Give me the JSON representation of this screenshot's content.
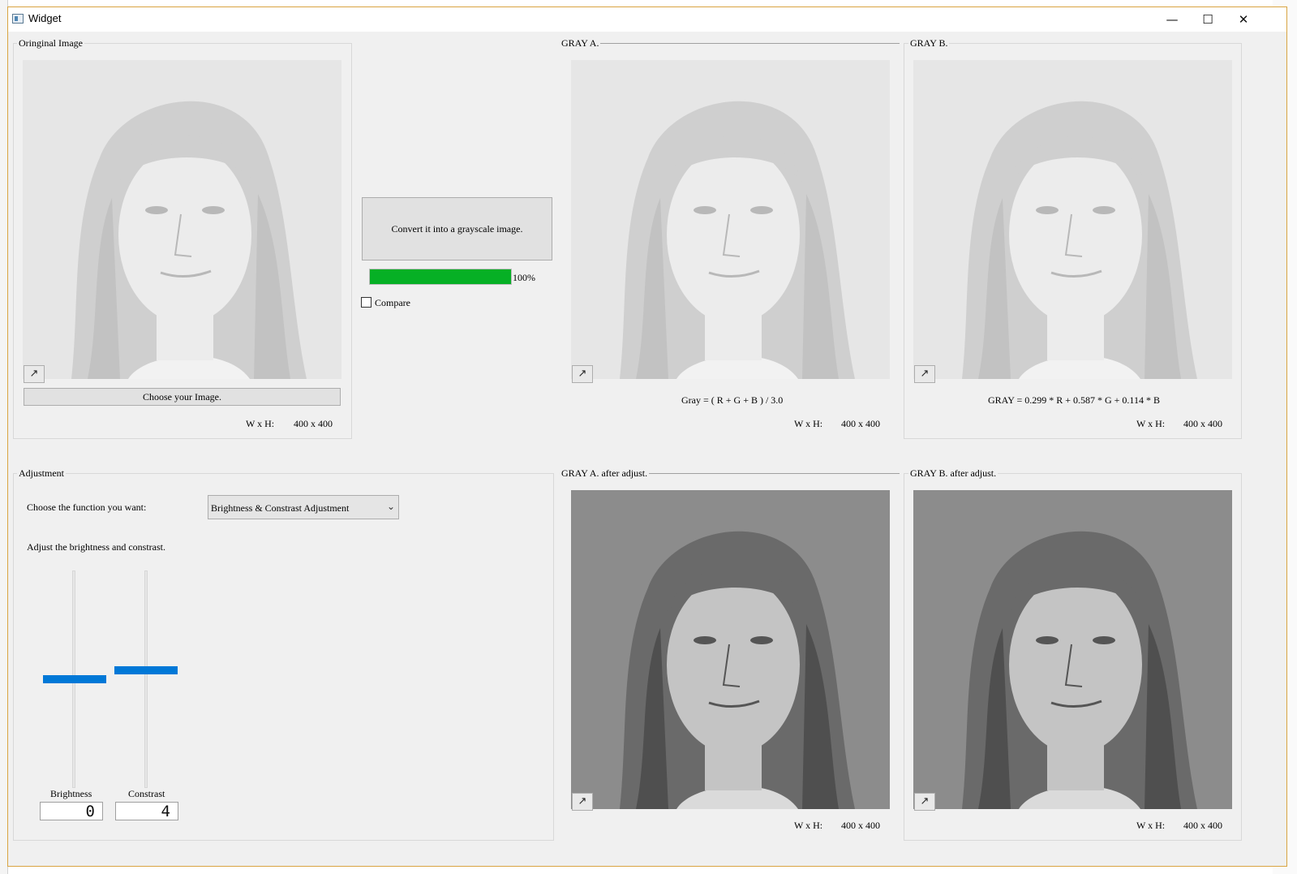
{
  "window": {
    "title": "Widget",
    "minimize_glyph": "—",
    "maximize_glyph": "☐",
    "close_glyph": "✕"
  },
  "original": {
    "group_label": "Oringinal Image",
    "choose_button": "Choose your Image.",
    "wh_label": "W x H:",
    "wh_value": "400 x 400",
    "tone": "light"
  },
  "convert": {
    "button_label": "Convert it into a grayscale image.",
    "progress_text": "100%",
    "progress_value": 1.0,
    "compare_label": "Compare",
    "compare_checked": false
  },
  "gray_a": {
    "group_label": "GRAY A.",
    "formula": "Gray = ( R + G + B ) / 3.0",
    "wh_label": "W x H:",
    "wh_value": "400 x 400",
    "tone": "light"
  },
  "gray_b": {
    "group_label": "GRAY B.",
    "formula": "GRAY = 0.299 * R + 0.587 * G + 0.114 * B",
    "wh_label": "W x H:",
    "wh_value": "400 x 400",
    "tone": "light"
  },
  "adjustment": {
    "group_label": "Adjustment",
    "choose_label": "Choose the function you want:",
    "combo_value": "Brightness & Constrast Adjustment",
    "adjust_label": "Adjust the brightness and constrast.",
    "brightness_label": "Brightness",
    "contrast_label": "Constrast",
    "brightness_value": "0",
    "contrast_value": "4",
    "brightness_level": 0.5,
    "contrast_level": 0.54
  },
  "gray_a_adj": {
    "group_label": "GRAY A. after adjust.",
    "wh_label": "W x H:",
    "wh_value": "400 x 400",
    "tone": "dark"
  },
  "gray_b_adj": {
    "group_label": "GRAY B. after adjust.",
    "wh_label": "W x H:",
    "wh_value": "400 x 400",
    "tone": "dark"
  },
  "icons": {
    "expand": "↗",
    "combo_arrow": "⌄"
  },
  "colors": {
    "progress_green": "#06b025",
    "slider_blue": "#0078d7",
    "window_border": "#d9a441"
  }
}
